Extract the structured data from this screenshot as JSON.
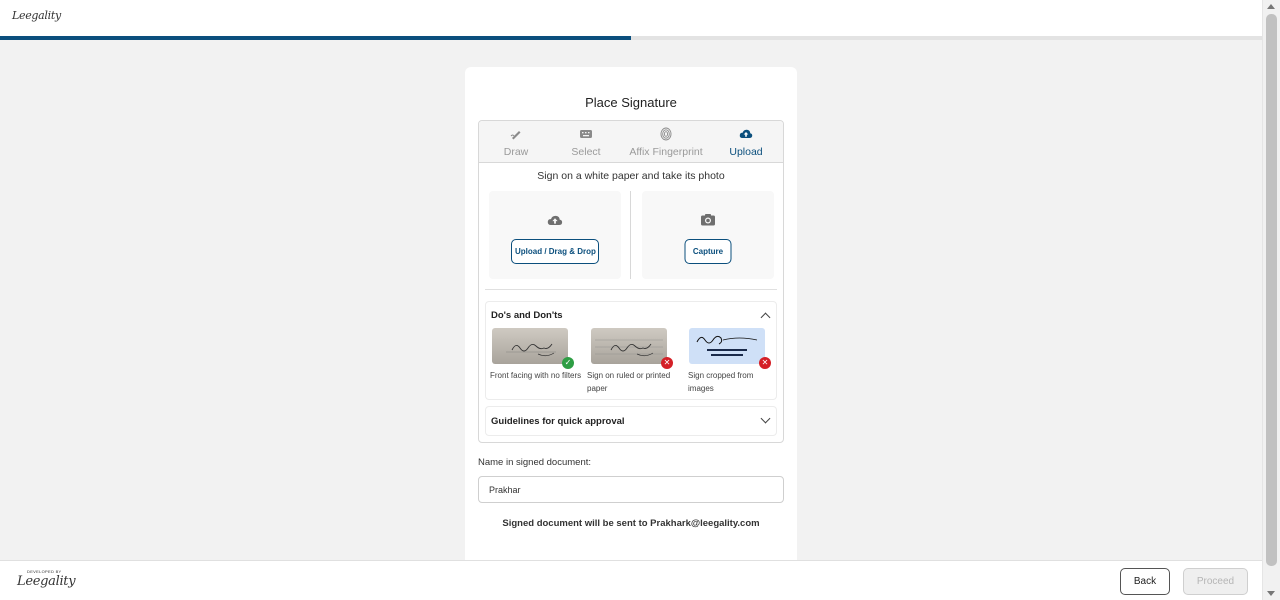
{
  "header": {
    "logo_text": "Leegality",
    "progress_percent": 50
  },
  "card": {
    "title": "Place Signature",
    "tabs": [
      {
        "label": "Draw",
        "icon": "pen-icon",
        "active": false
      },
      {
        "label": "Select",
        "icon": "keyboard-icon",
        "active": false
      },
      {
        "label": "Affix Fingerprint",
        "icon": "fingerprint-icon",
        "active": false
      },
      {
        "label": "Upload",
        "icon": "cloud-upload-icon",
        "active": true
      }
    ],
    "instruction": "Sign on a white paper and take its photo",
    "upload_button": "Upload / Drag & Drop",
    "capture_button": "Capture",
    "dos_title": "Do's and Don'ts",
    "samples": [
      {
        "caption": "Front facing with no filters",
        "status": "ok"
      },
      {
        "caption": "Sign on ruled or printed paper",
        "status": "no"
      },
      {
        "caption": "Sign cropped from images",
        "status": "no"
      }
    ],
    "guidelines_title": "Guidelines for quick approval",
    "name_label": "Name in signed document:",
    "name_value": "Prakhar",
    "sent_note": "Signed document will be sent to Prakhark@leegality.com"
  },
  "footer": {
    "logo_small": "DEVELOPED BY",
    "logo_text": "Leegality",
    "back_label": "Back",
    "proceed_label": "Proceed"
  },
  "colors": {
    "accent": "#0b4f7d",
    "ok": "#2e9e44",
    "error": "#d42027"
  }
}
